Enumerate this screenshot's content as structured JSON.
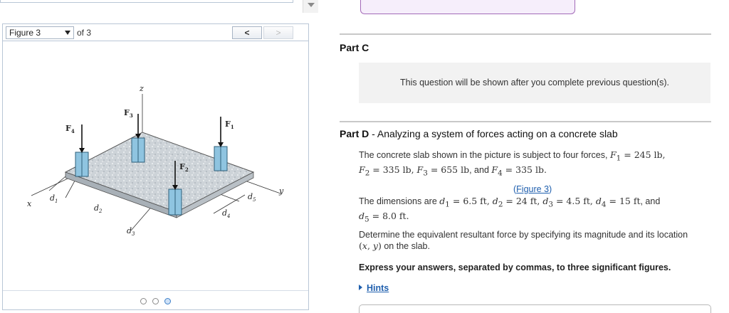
{
  "figure": {
    "selector_value": "Figure 3",
    "of_label": "of 3",
    "prev_label": "<",
    "next_label": ">",
    "labels": {
      "z": "z",
      "x": "x",
      "y": "y",
      "F1": "F",
      "F1_sub": "1",
      "F2": "F",
      "F2_sub": "2",
      "F3": "F",
      "F3_sub": "3",
      "F4": "F",
      "F4_sub": "4",
      "d1": "d",
      "d1_sub": "1",
      "d2": "d",
      "d2_sub": "2",
      "d3": "d",
      "d3_sub": "3",
      "d4": "d",
      "d4_sub": "4",
      "d5": "d",
      "d5_sub": "5"
    },
    "dots_count": 3,
    "active_dot": 3
  },
  "partC": {
    "title": "Part C",
    "locked_text": "This question will be shown after you complete previous question(s)."
  },
  "partD": {
    "title_bold": "Part D",
    "title_rest": " - Analyzing a system of forces acting on a concrete slab",
    "intro_text": "The concrete slab shown in the picture is subject to four forces,",
    "forces": {
      "F1": "245 lb",
      "F2": "335 lb",
      "F3": "655 lb",
      "F4": "335 lb"
    },
    "figure_link": "Figure 3",
    "dimensions_text": "The dimensions are",
    "dimensions": {
      "d1": "6.5 ft",
      "d2": "24 ft",
      "d3": "4.5 ft",
      "d4": "15 ft",
      "d5": "8.0 ft"
    },
    "determine_text": "Determine the equivalent resultant force by specifying its magnitude and its location",
    "location_tail": "on the slab.",
    "express_text": "Express your answers, separated by commas, to three significant figures.",
    "hints_label": "Hints"
  },
  "colors": {
    "accent_link": "#1f5fae",
    "slab_top": "#cfd6dc",
    "column": "#8fc4e0",
    "panel_border": "#b9c6d6"
  }
}
